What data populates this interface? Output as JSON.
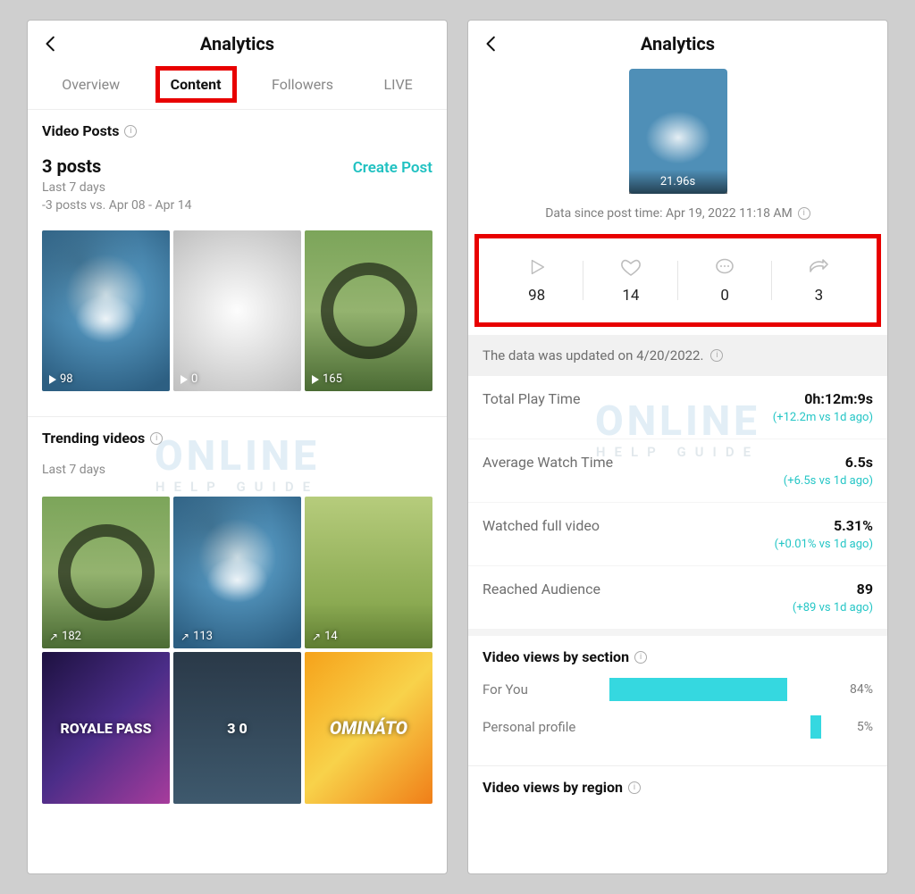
{
  "left": {
    "title": "Analytics",
    "tabs": [
      "Overview",
      "Content",
      "Followers",
      "LIVE"
    ],
    "active_tab_index": 1,
    "video_posts_section": "Video Posts",
    "posts_count": "3 posts",
    "posts_period": "Last 7 days",
    "posts_delta": "-3 posts vs. Apr 08 - Apr 14",
    "create_post": "Create Post",
    "post_thumbs": [
      {
        "plays": "98"
      },
      {
        "plays": "0"
      },
      {
        "plays": "165"
      }
    ],
    "trending_title": "Trending videos",
    "trending_period": "Last 7 days",
    "trending": [
      {
        "count": "182"
      },
      {
        "count": "113"
      },
      {
        "count": "14"
      },
      {
        "overlay": "ROYALE PASS"
      },
      {
        "overlay": "3    0"
      },
      {
        "overlay": "OMINÁTO"
      }
    ]
  },
  "right": {
    "title": "Analytics",
    "hero_duration": "21.96s",
    "hero_caption": "Data since post time: Apr 19, 2022 11:18 AM",
    "stats": {
      "plays": "98",
      "likes": "14",
      "comments": "0",
      "shares": "3"
    },
    "updated": "The data was updated on 4/20/2022.",
    "metrics": [
      {
        "label": "Total Play Time",
        "value": "0h:12m:9s",
        "delta": "(+12.2m vs 1d ago)"
      },
      {
        "label": "Average Watch Time",
        "value": "6.5s",
        "delta": "(+6.5s vs 1d ago)"
      },
      {
        "label": "Watched full video",
        "value": "5.31%",
        "delta": "(+0.01% vs 1d ago)"
      },
      {
        "label": "Reached Audience",
        "value": "89",
        "delta": "(+89 vs 1d ago)"
      }
    ],
    "views_section_title": "Video views by section",
    "views_region_title": "Video views by region"
  },
  "chart_data": {
    "type": "bar",
    "orientation": "horizontal",
    "title": "Video views by section",
    "xlabel": "",
    "ylabel": "",
    "xlim": [
      0,
      100
    ],
    "categories": [
      "For You",
      "Personal profile"
    ],
    "values": [
      84,
      5
    ]
  }
}
